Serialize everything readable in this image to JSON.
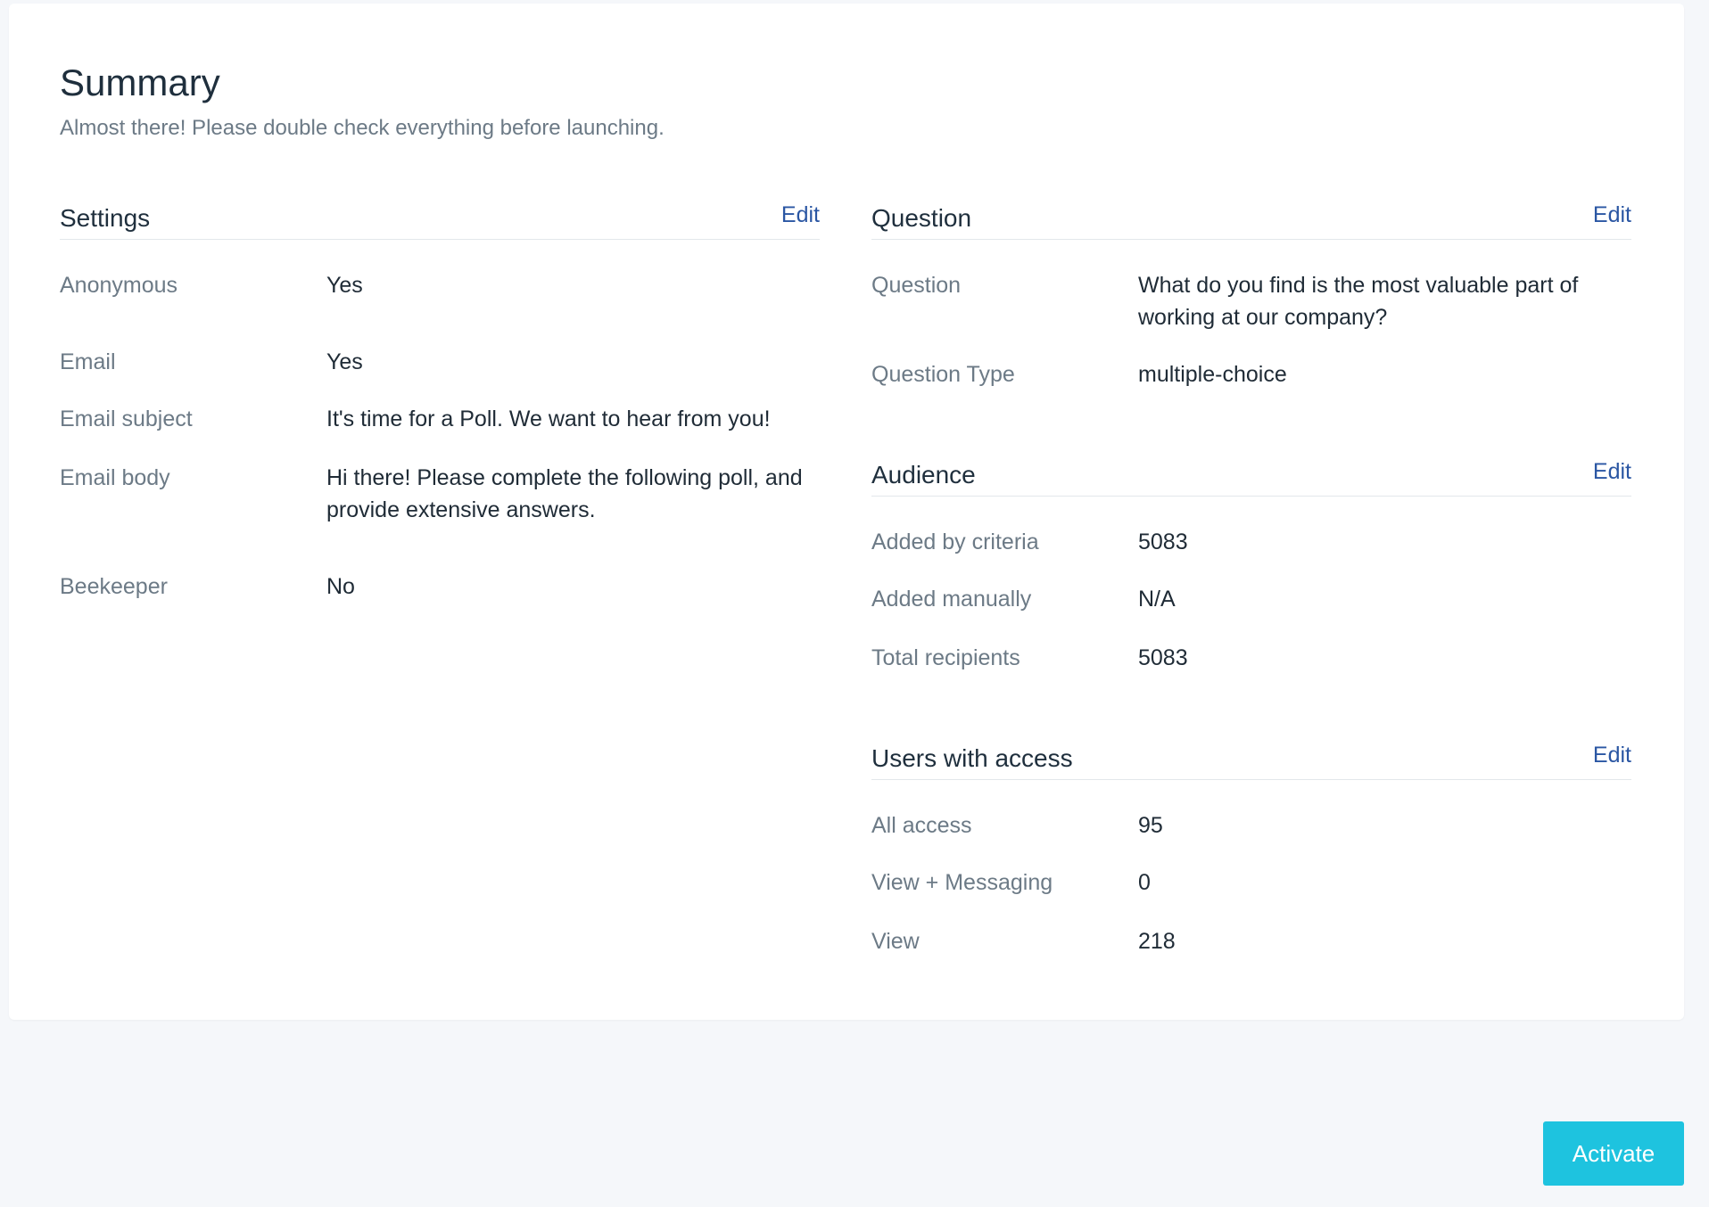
{
  "summary": {
    "title": "Summary",
    "subtitle": "Almost there! Please double check everything before launching."
  },
  "settings": {
    "title": "Settings",
    "edit_label": "Edit",
    "rows": [
      {
        "label": "Anonymous",
        "value": "Yes"
      },
      {
        "label": "Email",
        "value": "Yes"
      },
      {
        "label": "Email subject",
        "value": "It's time for a Poll. We want to hear from you!"
      },
      {
        "label": "Email body",
        "value": "Hi there! Please complete the following poll, and provide extensive answers."
      },
      {
        "label": "Beekeeper",
        "value": "No"
      }
    ]
  },
  "question": {
    "title": "Question",
    "edit_label": "Edit",
    "rows": [
      {
        "label": "Question",
        "value": "What do you find is the most valuable part of working at our company?"
      },
      {
        "label": "Question Type",
        "value": "multiple-choice"
      }
    ]
  },
  "audience": {
    "title": "Audience",
    "edit_label": "Edit",
    "rows": [
      {
        "label": "Added by criteria",
        "value": "5083"
      },
      {
        "label": "Added manually",
        "value": "N/A"
      },
      {
        "label": "Total recipients",
        "value": "5083"
      }
    ]
  },
  "users_with_access": {
    "title": "Users with access",
    "edit_label": "Edit",
    "rows": [
      {
        "label": "All access",
        "value": "95"
      },
      {
        "label": "View + Messaging",
        "value": "0"
      },
      {
        "label": "View",
        "value": "218"
      }
    ]
  },
  "actions": {
    "activate_label": "Activate"
  },
  "colors": {
    "background": "#f5f7fa",
    "card": "#ffffff",
    "link": "#2a56a3",
    "primary_button": "#1ec3df",
    "label_text": "#6c7a86",
    "value_text": "#1f2b36"
  }
}
